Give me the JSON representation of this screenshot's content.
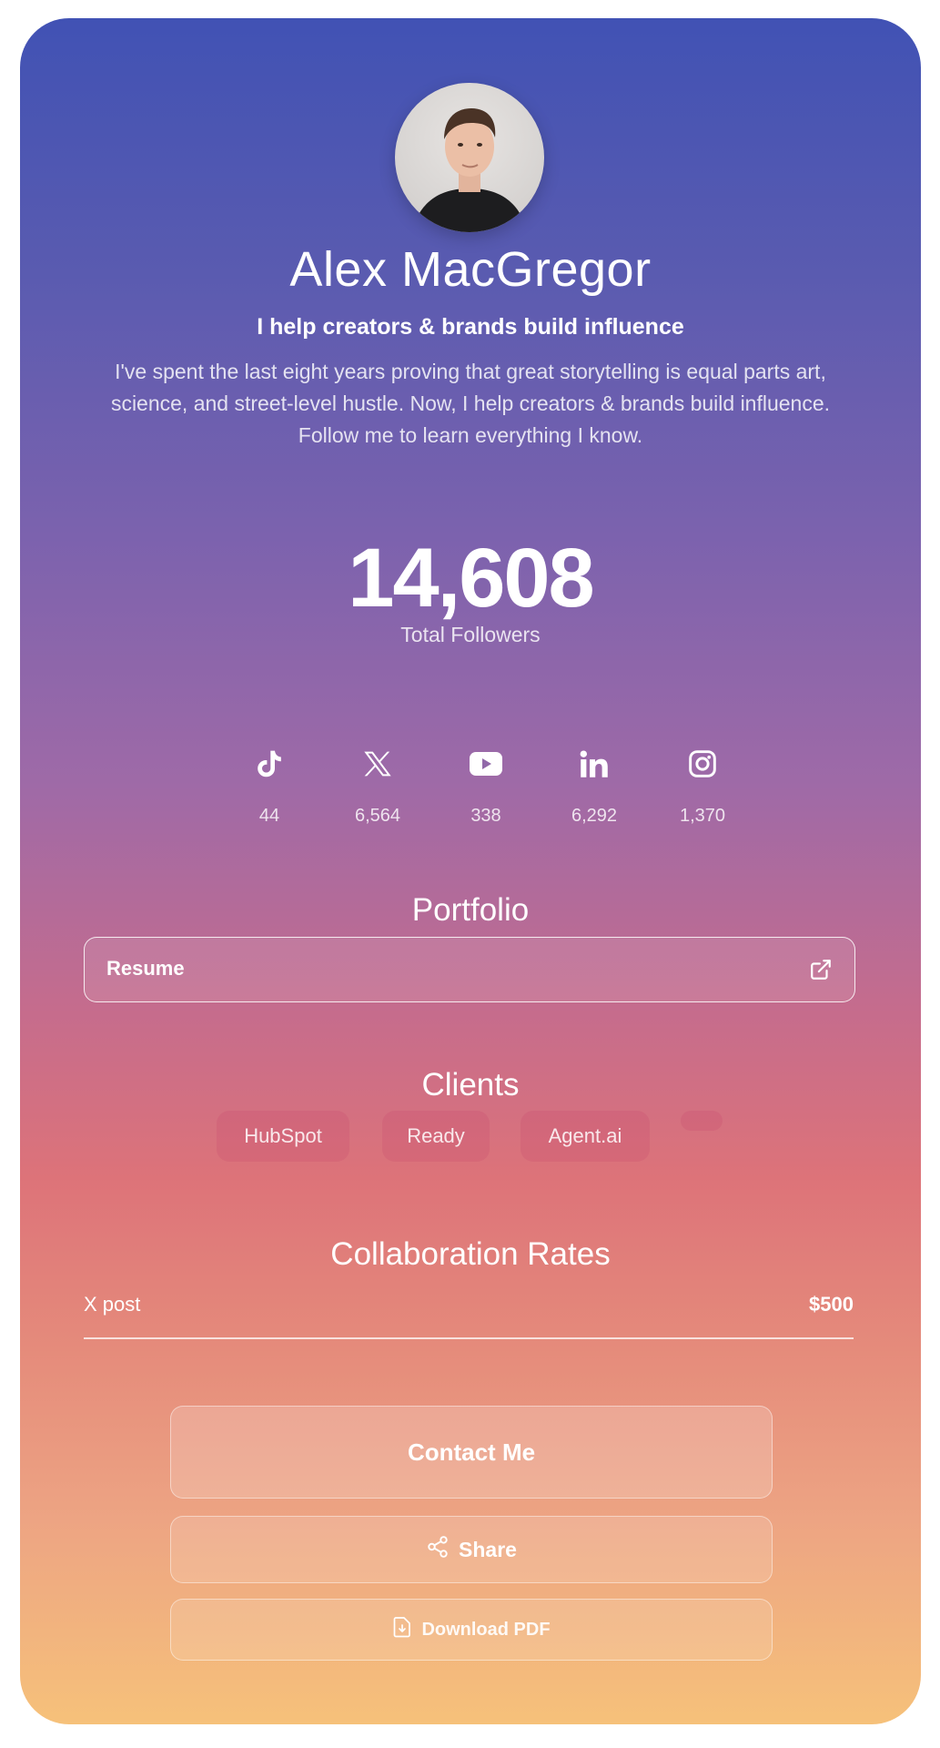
{
  "profile": {
    "name": "Alex MacGregor",
    "tagline": "I help creators & brands build influence",
    "bio": "I've spent the last eight years proving that great storytelling is equal parts art, science, and street-level hustle. Now, I help creators & brands build influence. Follow me to learn everything I know.",
    "avatar_icon": "person-photo"
  },
  "stats": {
    "total_followers": "14,608",
    "total_followers_label": "Total Followers"
  },
  "socials": [
    {
      "icon": "tiktok-icon",
      "count": "44"
    },
    {
      "icon": "x-icon",
      "count": "6,564"
    },
    {
      "icon": "youtube-icon",
      "count": "338"
    },
    {
      "icon": "linkedin-icon",
      "count": "6,292"
    },
    {
      "icon": "instagram-icon",
      "count": "1,370"
    }
  ],
  "portfolio": {
    "title": "Portfolio",
    "items": [
      {
        "label": "Resume",
        "icon": "external-link-icon"
      }
    ]
  },
  "clients": {
    "title": "Clients",
    "items": [
      "HubSpot",
      "Ready",
      "Agent.ai",
      ""
    ]
  },
  "rates": {
    "title": "Collaboration Rates",
    "items": [
      {
        "label": "X post",
        "price": "$500"
      }
    ]
  },
  "actions": {
    "contact_label": "Contact Me",
    "share_label": "Share",
    "download_label": "Download PDF"
  },
  "colors": {
    "gradient_top": "#4152b4",
    "gradient_middle": "#dd7379",
    "gradient_bottom": "#f6c17a"
  }
}
